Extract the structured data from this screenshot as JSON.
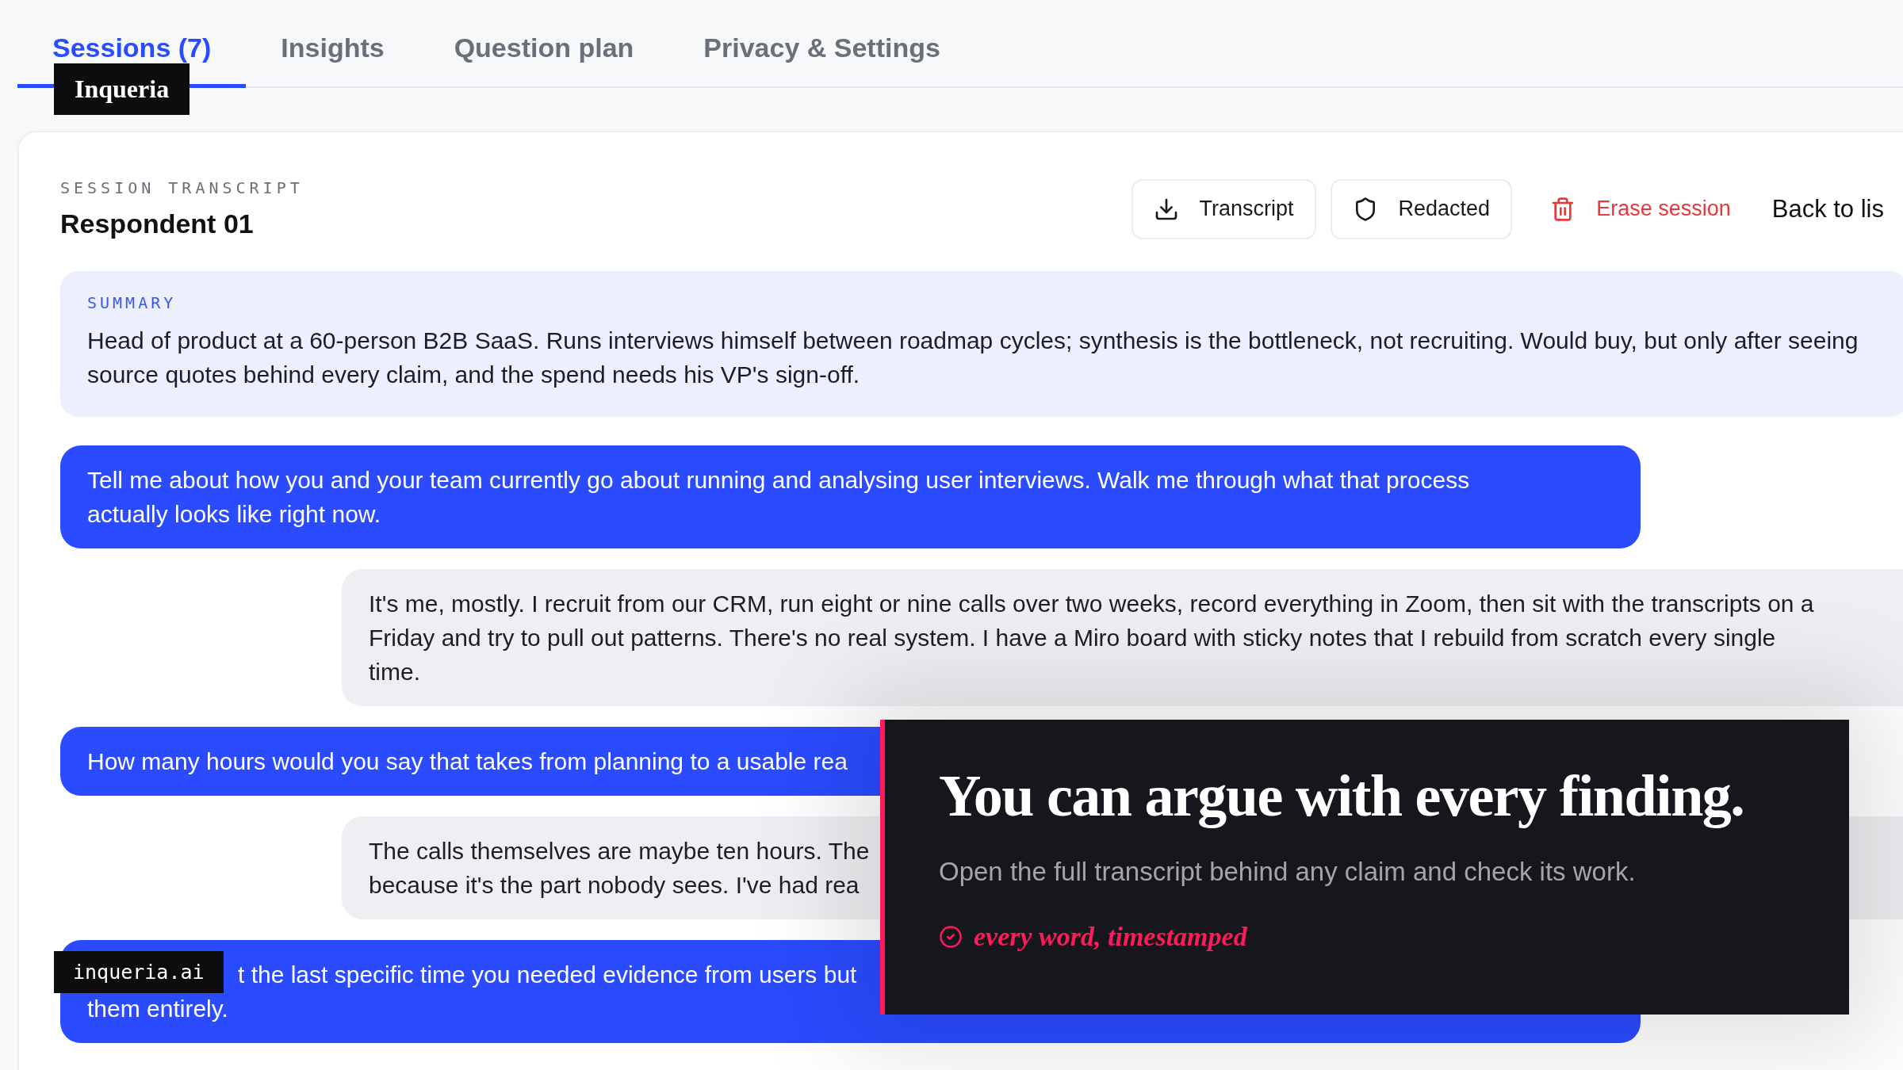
{
  "tabs": [
    {
      "label": "Sessions (7)",
      "selected": true
    },
    {
      "label": "Insights",
      "selected": false
    },
    {
      "label": "Question plan",
      "selected": false
    },
    {
      "label": "Privacy & Settings",
      "selected": false
    }
  ],
  "brand_tags": [
    {
      "kind": "logo",
      "text": "Inqueria"
    },
    {
      "kind": "url",
      "text": "inqueria.ai"
    }
  ],
  "session": {
    "eyebrow": "SESSION TRANSCRIPT",
    "title": "Respondent 01",
    "actions": [
      {
        "kind": "download",
        "label": "Transcript"
      },
      {
        "kind": "shield",
        "label": "Redacted"
      },
      {
        "kind": "erase",
        "label": "Erase session"
      },
      {
        "kind": "link",
        "label": "Back to lis"
      }
    ]
  },
  "summary": {
    "label": "SUMMARY",
    "text": "Head of product at a 60-person B2B SaaS. Runs interviews himself between roadmap cycles; synthesis is the bottleneck, not recruiting. Would buy, but only after seeing source quotes behind every claim, and the spend needs his VP's sign-off."
  },
  "messages": [
    {
      "kind": "question",
      "lines": [
        "Tell me about how you and your team currently go about running and analysing user interviews. Walk me through what that process",
        "actually looks like right now."
      ]
    },
    {
      "kind": "answer",
      "lines": [
        "It's me, mostly. I recruit from our CRM, run eight or nine calls over two weeks, record everything in Zoom, then sit with the transcripts on a",
        "Friday and try to pull out patterns. There's no real system. I have a Miro board with sticky notes that I rebuild from scratch every single",
        "time."
      ]
    },
    {
      "kind": "question",
      "lines": [
        "How many hours would you say that takes from planning to a usable rea"
      ]
    },
    {
      "kind": "answer",
      "lines": [
        "The calls themselves are maybe ten hours. The",
        "because it's the part nobody sees. I've had rea"
      ]
    },
    {
      "kind": "question",
      "lines": [
        "t the last specific time you needed evidence from users but",
        "them entirely."
      ]
    }
  ],
  "callout": {
    "headline": "You can argue with every finding.",
    "subtitle": "Open the full transcript behind any claim and check its work.",
    "tag": "every word, timestamped"
  }
}
